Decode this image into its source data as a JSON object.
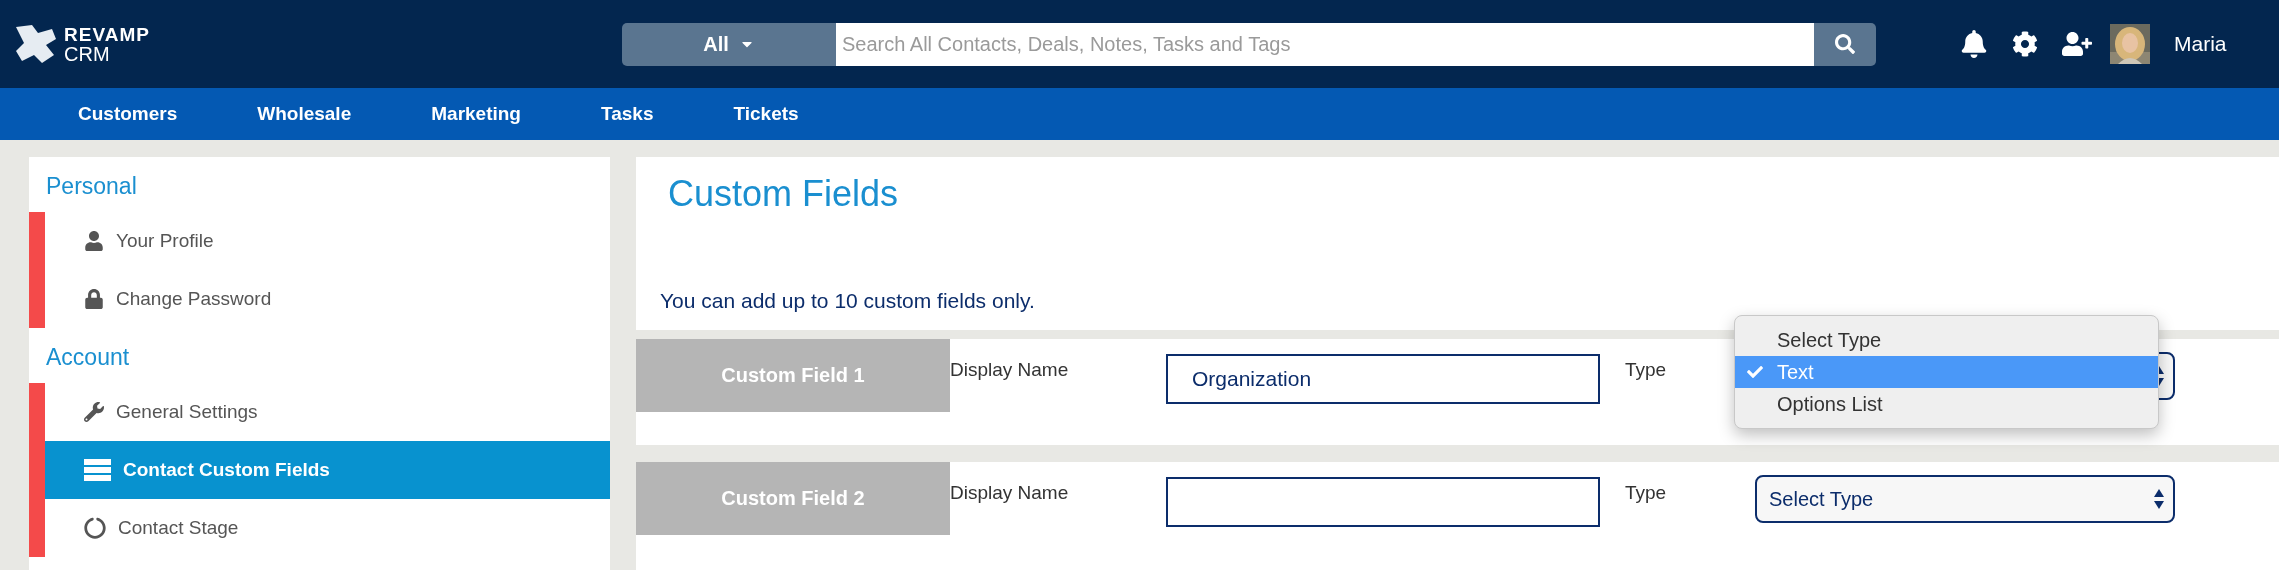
{
  "header": {
    "logo": {
      "line_1": "REVAMP",
      "line_2": "CRM"
    },
    "search": {
      "scope": "All",
      "placeholder": "Search All Contacts, Deals, Notes, Tasks and Tags"
    },
    "user": {
      "name": "Maria"
    }
  },
  "nav": [
    {
      "label": "Customers"
    },
    {
      "label": "Wholesale"
    },
    {
      "label": "Marketing"
    },
    {
      "label": "Tasks"
    },
    {
      "label": "Tickets"
    }
  ],
  "sidebar": {
    "sections": [
      {
        "title": "Personal",
        "items": [
          {
            "label": "Your Profile",
            "selected": false
          },
          {
            "label": "Change Password",
            "selected": false
          }
        ]
      },
      {
        "title": "Account",
        "items": [
          {
            "label": "General Settings",
            "selected": false
          },
          {
            "label": "Contact Custom Fields",
            "selected": true
          },
          {
            "label": "Contact Stage",
            "selected": false
          }
        ]
      }
    ]
  },
  "main": {
    "title": "Custom Fields",
    "note": "You can add up to 10 custom fields only.",
    "fields": [
      {
        "label": "Custom Field 1",
        "display_name_label": "Display Name",
        "value": "Organization",
        "type_label": "Type",
        "type_menu": {
          "options": [
            {
              "label": "Select Type",
              "selected": false
            },
            {
              "label": "Text",
              "selected": true
            },
            {
              "label": "Options List",
              "selected": false
            }
          ]
        }
      },
      {
        "label": "Custom Field 2",
        "display_name_label": "Display Name",
        "type_label": "Type",
        "type_value": "Select Type"
      }
    ]
  }
}
